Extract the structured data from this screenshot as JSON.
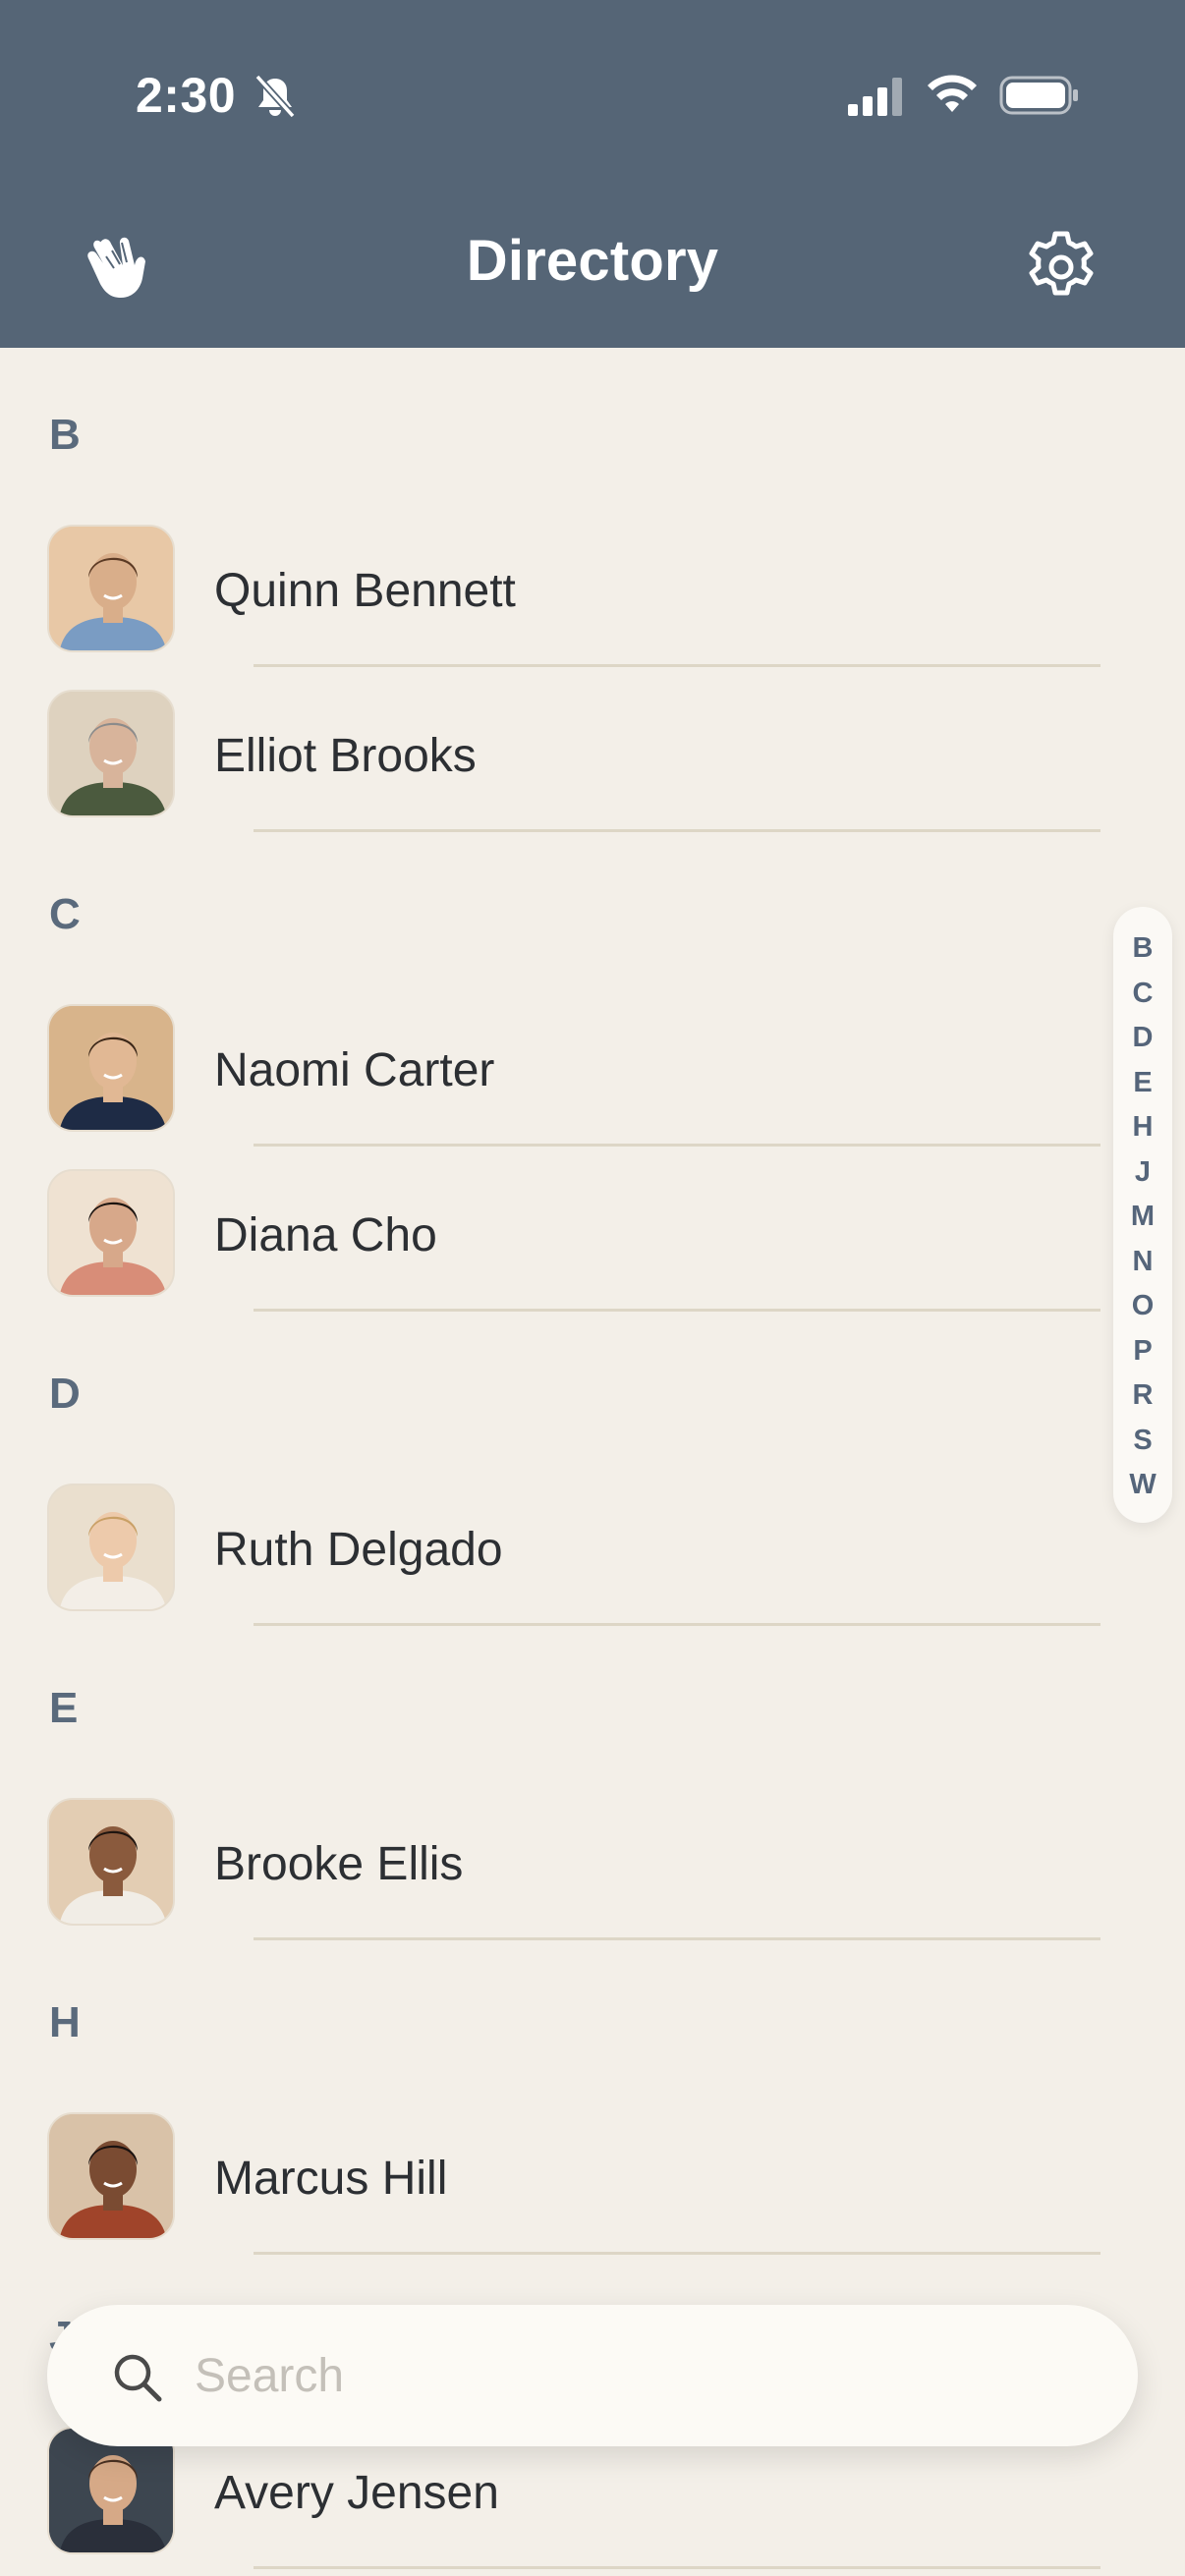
{
  "status_bar": {
    "time": "2:30"
  },
  "header": {
    "title": "Directory"
  },
  "sections": [
    {
      "letter": "B",
      "contacts": [
        {
          "name": "Quinn Bennett",
          "skin": "#d9ae8a",
          "hair": "#5b3a24",
          "shirt": "#7a9cc3",
          "bg": "#e8c8a6"
        },
        {
          "name": "Elliot Brooks",
          "skin": "#d8b49b",
          "hair": "#8b8b8b",
          "shirt": "#4b5a3e",
          "bg": "#ded2bf"
        }
      ]
    },
    {
      "letter": "C",
      "contacts": [
        {
          "name": "Naomi Carter",
          "skin": "#e1b894",
          "hair": "#3b2718",
          "shirt": "#1e2b45",
          "bg": "#d8b48b"
        },
        {
          "name": "Diana Cho",
          "skin": "#d7a88a",
          "hair": "#1c1410",
          "shirt": "#d88d78",
          "bg": "#efe2d2"
        }
      ]
    },
    {
      "letter": "D",
      "contacts": [
        {
          "name": "Ruth Delgado",
          "skin": "#edcaab",
          "hair": "#c9a066",
          "shirt": "#f3eee7",
          "bg": "#eadfce"
        }
      ]
    },
    {
      "letter": "E",
      "contacts": [
        {
          "name": "Brooke Ellis",
          "skin": "#8a5a3d",
          "hair": "#1f1510",
          "shirt": "#f1ede6",
          "bg": "#e3cdb3"
        }
      ]
    },
    {
      "letter": "H",
      "contacts": [
        {
          "name": "Marcus Hill",
          "skin": "#7a4b32",
          "hair": "#1a1210",
          "shirt": "#a0442a",
          "bg": "#d9c2a8"
        }
      ]
    },
    {
      "letter": "J",
      "contacts": [
        {
          "name": "Avery Jensen",
          "skin": "#d6a987",
          "hair": "#4a3122",
          "shirt": "#2a2f3a",
          "bg": "#3d4650"
        }
      ]
    }
  ],
  "index_letters": [
    "B",
    "C",
    "D",
    "E",
    "H",
    "J",
    "M",
    "N",
    "O",
    "P",
    "R",
    "S",
    "W"
  ],
  "search": {
    "placeholder": "Search"
  },
  "colors": {
    "header": "#556576",
    "background": "#f3efe8",
    "section_letter": "#5a6a7c"
  }
}
